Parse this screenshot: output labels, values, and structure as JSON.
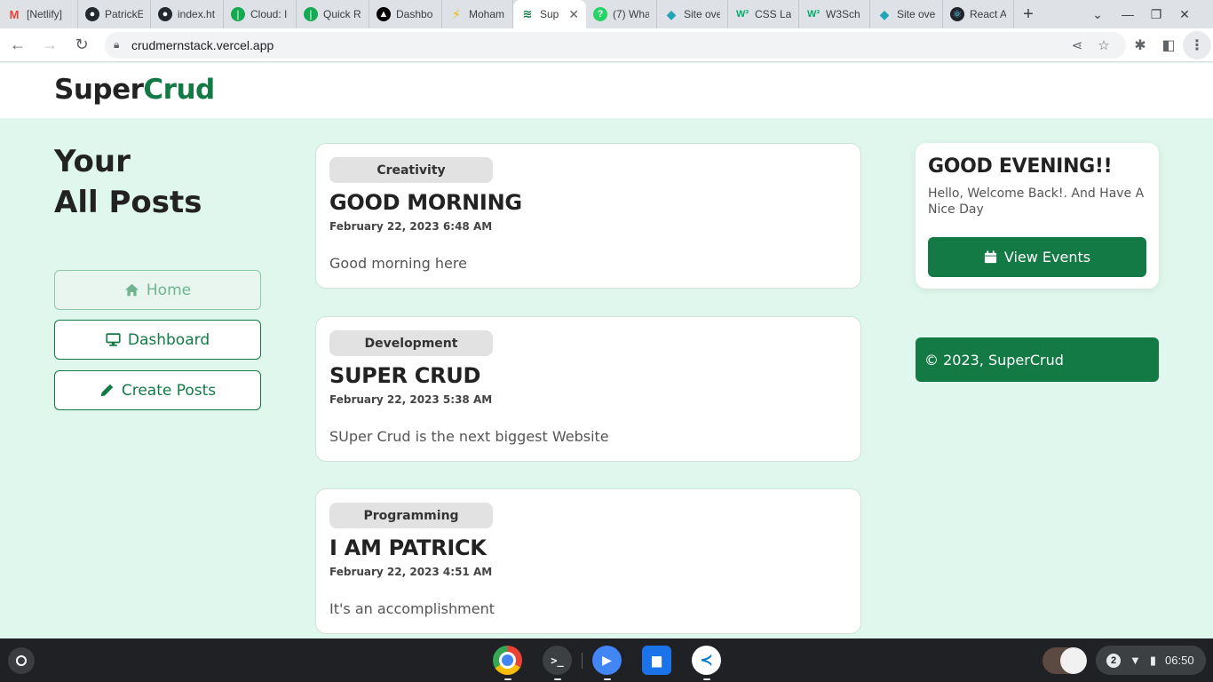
{
  "browser": {
    "tabs": [
      {
        "label": "[Netlify]",
        "icon": "gmail-icon",
        "color": "#ea4335"
      },
      {
        "label": "PatrickE",
        "icon": "github-icon",
        "color": "#24292f"
      },
      {
        "label": "index.ht",
        "icon": "github-icon",
        "color": "#24292f"
      },
      {
        "label": "Cloud: I",
        "icon": "mongodb-icon",
        "color": "#13aa52"
      },
      {
        "label": "Quick R",
        "icon": "mongodb-icon",
        "color": "#13aa52"
      },
      {
        "label": "Dashbo",
        "icon": "vercel-icon",
        "color": "#000000"
      },
      {
        "label": "Moham",
        "icon": "bolt-icon",
        "color": "#f4b400"
      },
      {
        "label": "Sup",
        "icon": "supercrud-icon",
        "color": "#137a46",
        "active": true
      },
      {
        "label": "(7) Wha",
        "icon": "whatsapp-icon",
        "color": "#25d366"
      },
      {
        "label": "Site ove",
        "icon": "netlify-icon",
        "color": "#20a6b8"
      },
      {
        "label": "CSS La",
        "icon": "w3schools-icon",
        "color": "#04aa6d"
      },
      {
        "label": "W3Sch",
        "icon": "w3schools-icon",
        "color": "#04aa6d"
      },
      {
        "label": "Site ove",
        "icon": "netlify-icon",
        "color": "#20a6b8"
      },
      {
        "label": "React A",
        "icon": "react-icon",
        "color": "#61dafb"
      }
    ],
    "url": "crudmernstack.vercel.app"
  },
  "site": {
    "logo_part1": "Super",
    "logo_part2": "Crud",
    "accent_color": "#137a46",
    "heading_line1": "Your",
    "heading_line2": "All Posts",
    "nav": {
      "home": "Home",
      "dashboard": "Dashboard",
      "create": "Create Posts"
    },
    "posts": [
      {
        "category": "Creativity",
        "title": "GOOD MORNING",
        "date": "February 22, 2023 6:48 AM",
        "body": "Good morning here"
      },
      {
        "category": "Development",
        "title": "SUPER CRUD",
        "date": "February 22, 2023 5:38 AM",
        "body": "SUper Crud is the next biggest Website"
      },
      {
        "category": "Programming",
        "title": "I AM PATRICK",
        "date": "February 22, 2023 4:51 AM",
        "body": "It's an accomplishment"
      }
    ],
    "greeting": {
      "title": "GOOD EVENING!!",
      "message": "Hello, Welcome Back!. And Have A Nice Day",
      "button": "View Events"
    },
    "footer": "© 2023, SuperCrud"
  },
  "shelf": {
    "apps": [
      "chrome-icon",
      "terminal-icon",
      "play-icon",
      "files-icon",
      "vscode-icon"
    ],
    "notification_count": "2",
    "time": "06:50"
  }
}
